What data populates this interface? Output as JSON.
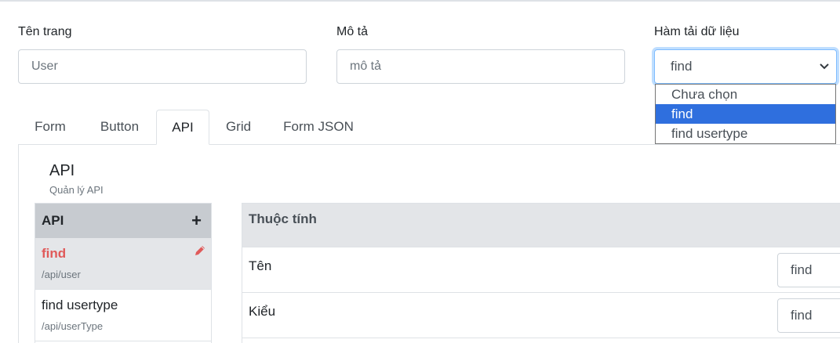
{
  "fields": {
    "page_name": {
      "label": "Tên trang",
      "value": "User"
    },
    "description": {
      "label": "Mô tả",
      "placeholder": "mô tả"
    },
    "loader": {
      "label": "Hàm tải dữ liệu",
      "value": "find",
      "options": [
        "Chưa chọn",
        "find",
        "find usertype"
      ],
      "selected_index": 1
    }
  },
  "tabs": [
    "Form",
    "Button",
    "API",
    "Grid",
    "Form JSON"
  ],
  "active_tab": "API",
  "api_section": {
    "title": "API",
    "subtitle": "Quản lý API",
    "list_header": "API",
    "add_icon": "plus-icon",
    "edit_icon": "pencil-icon",
    "items": [
      {
        "name": "find",
        "path": "/api/user",
        "active": true
      },
      {
        "name": "find usertype",
        "path": "/api/userType",
        "active": false
      }
    ]
  },
  "properties": {
    "header": "Thuộc tính",
    "rows": [
      {
        "label": "Tên",
        "value": "find"
      },
      {
        "label": "Kiểu",
        "value": "find"
      }
    ]
  },
  "colors": {
    "accent": "#2f6fde",
    "active_item_text": "#e05a5a",
    "header_bg": "#c7cbd0"
  }
}
